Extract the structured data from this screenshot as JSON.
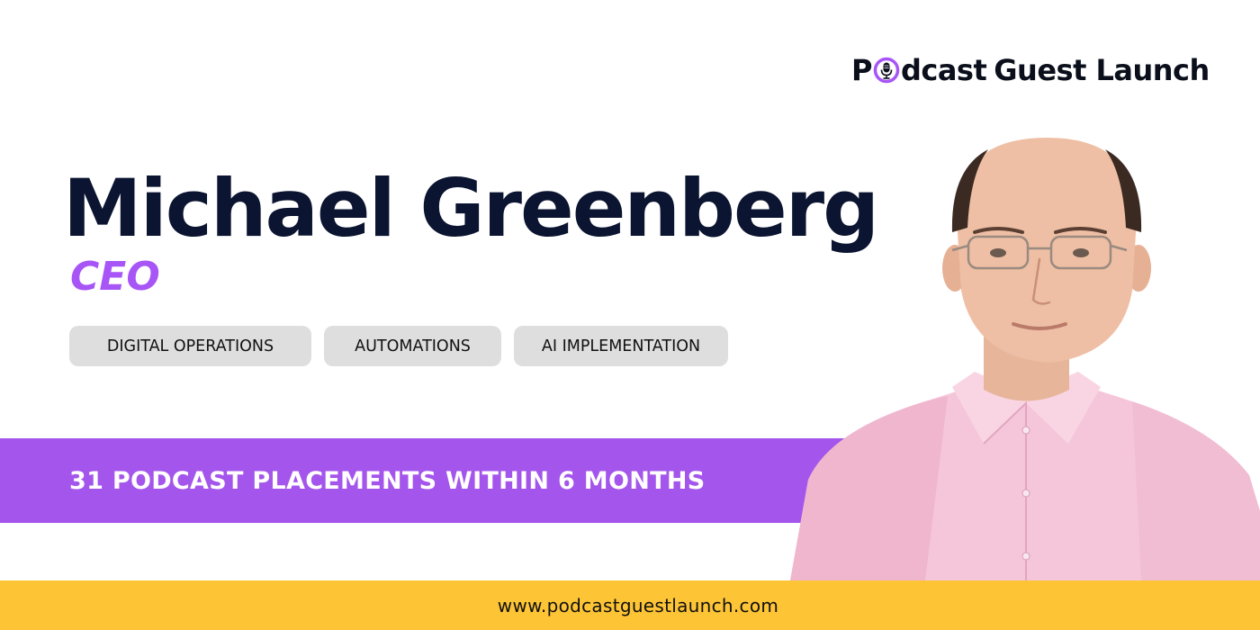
{
  "logo": {
    "text_before": "P",
    "text_after": "dcast",
    "text_rest": "Guest Launch",
    "icon": "microphone-icon",
    "accent_color": "#a855f7"
  },
  "profile": {
    "name": "Michael Greenberg",
    "role": "CEO"
  },
  "tags": [
    "DIGITAL OPERATIONS",
    "AUTOMATIONS",
    "AI IMPLEMENTATION"
  ],
  "banner": {
    "text": "31 PODCAST PLACEMENTS WITHIN 6 MONTHS",
    "color": "#a455ec"
  },
  "footer": {
    "url": "www.podcastguestlaunch.com",
    "color": "#fdc435"
  }
}
